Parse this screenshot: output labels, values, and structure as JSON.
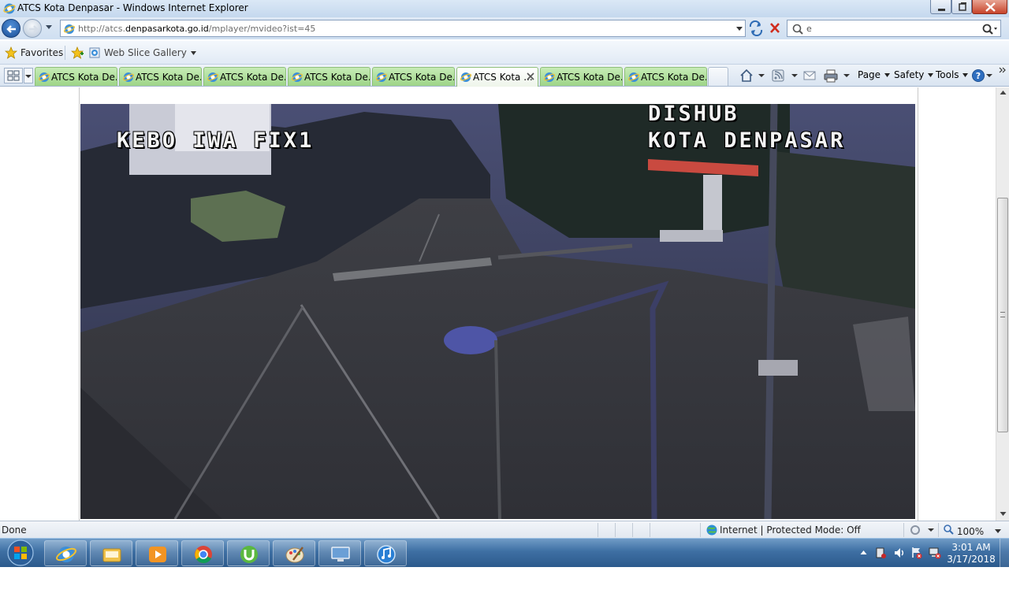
{
  "window": {
    "title": "ATCS Kota Denpasar - Windows Internet Explorer"
  },
  "navigation": {
    "address_prefix": "http://atcs.",
    "address_domain": "denpasarkota.go.id",
    "address_suffix": "/mplayer/mvideo?ist=45",
    "search_value": "e"
  },
  "favorites_bar": {
    "favorites_label": "Favorites",
    "web_slice_label": "Web Slice Gallery"
  },
  "tabs": [
    {
      "label": "ATCS Kota De..."
    },
    {
      "label": "ATCS Kota De..."
    },
    {
      "label": "ATCS Kota De..."
    },
    {
      "label": "ATCS Kota De..."
    },
    {
      "label": "ATCS Kota De..."
    },
    {
      "label": "ATCS Kota ...",
      "active": true
    },
    {
      "label": "ATCS Kota De..."
    },
    {
      "label": "ATCS Kota De..."
    }
  ],
  "command_bar": {
    "page_label": "Page",
    "safety_label": "Safety",
    "tools_label": "Tools"
  },
  "video": {
    "camera_label": "KEBO IWA FIX1",
    "overlay_line1": "DISHUB",
    "overlay_line2": "KOTA DENPASAR"
  },
  "status_bar": {
    "status": "Done",
    "zone": "Internet | Protected Mode: Off",
    "zoom": "100%"
  },
  "taskbar": {
    "time": "3:01 AM",
    "date": "3/17/2018",
    "pinned": [
      "internet-explorer",
      "windows-explorer",
      "media-player",
      "chrome",
      "utorrent",
      "paint",
      "remote-desktop",
      "itunes"
    ]
  },
  "colors": {
    "tab_green": "#9dd488",
    "taskbar_blue": "#3e6fa3",
    "close_red": "#c7442b"
  }
}
